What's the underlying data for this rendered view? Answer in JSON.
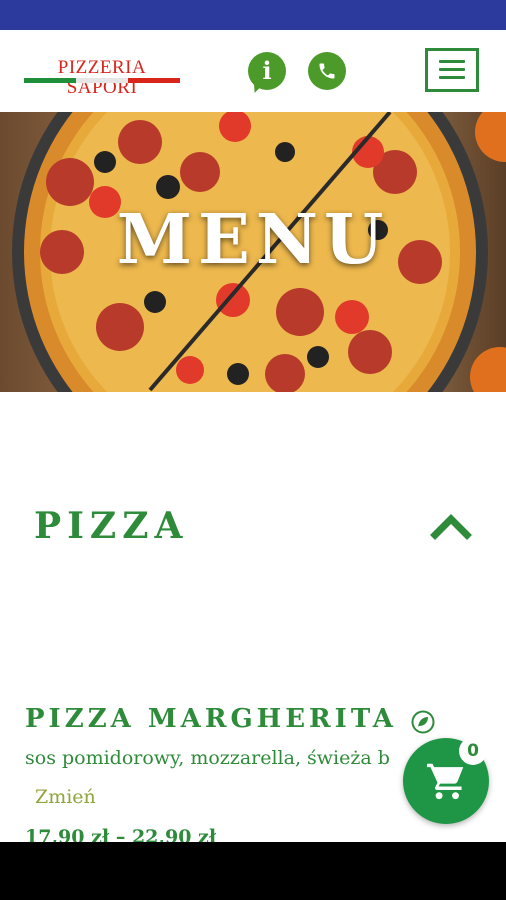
{
  "header": {
    "logo_text": "PIZZERIA SAPORI",
    "info_icon": "info-icon",
    "phone_icon": "phone-icon",
    "menu_icon": "hamburger-menu-icon",
    "brand_green": "#2e8b3a",
    "brand_red": "#d9261c"
  },
  "hero": {
    "title": "MENU"
  },
  "category": {
    "name": "PIZZA",
    "toggle_icon": "chevron-up-icon"
  },
  "item": {
    "name": "PIZZA MARGHERITA",
    "vegetarian_icon": "leaf-icon",
    "description": "sos pomidorowy, mozzarella, świeża b",
    "change_label": "Zmień",
    "price": "17,90 zł – 22,90 zł"
  },
  "cart": {
    "icon": "shopping-cart-icon",
    "count": "0",
    "color": "#1e9646"
  }
}
